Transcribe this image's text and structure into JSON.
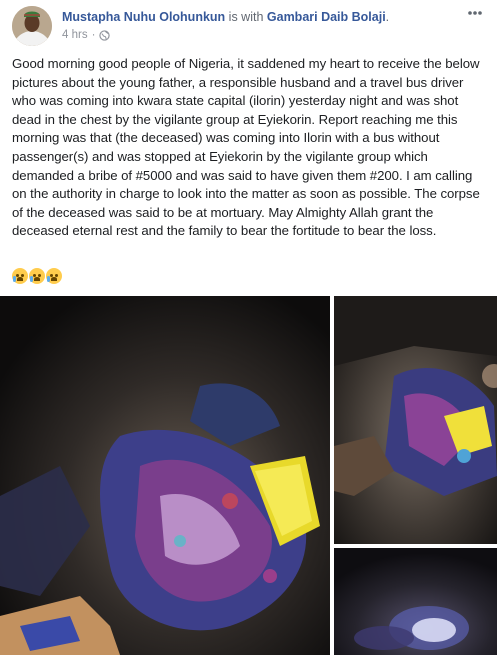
{
  "post": {
    "author": "Mustapha Nuhu Olohunkun",
    "with_text": "is with",
    "tagged": "Gambari Daib Bolaji",
    "tagged_suffix": ".",
    "time": "4 hrs",
    "separator": "·",
    "privacy_icon": "globe-icon",
    "more_icon": "more-horizontal-icon",
    "text": "Good morning good people of Nigeria, it saddened my heart to receive the below pictures about the young father, a responsible husband and a travel bus driver who was coming into kwara state capital (ilorin) yesterday night and was shot dead in the chest by the vigilante group at Eyiekorin. Report reaching me this morning was that (the deceased) was coming into Ilorin with a bus without passenger(s) and was stopped at Eyiekorin by the vigilante group which demanded a bribe of #5000 and was said to have given them #200. I am calling on the authority in charge to look into the matter as soon as possible. The corpse of the deceased was said to be at mortuary. May Almighty Allah grant the deceased eternal rest and the family to bear the fortitude to bear the loss.",
    "emojis": [
      "crying-face-emoji",
      "crying-face-emoji",
      "crying-face-emoji"
    ]
  },
  "colors": {
    "link": "#365899",
    "muted": "#90949c",
    "text": "#1c1e21"
  }
}
